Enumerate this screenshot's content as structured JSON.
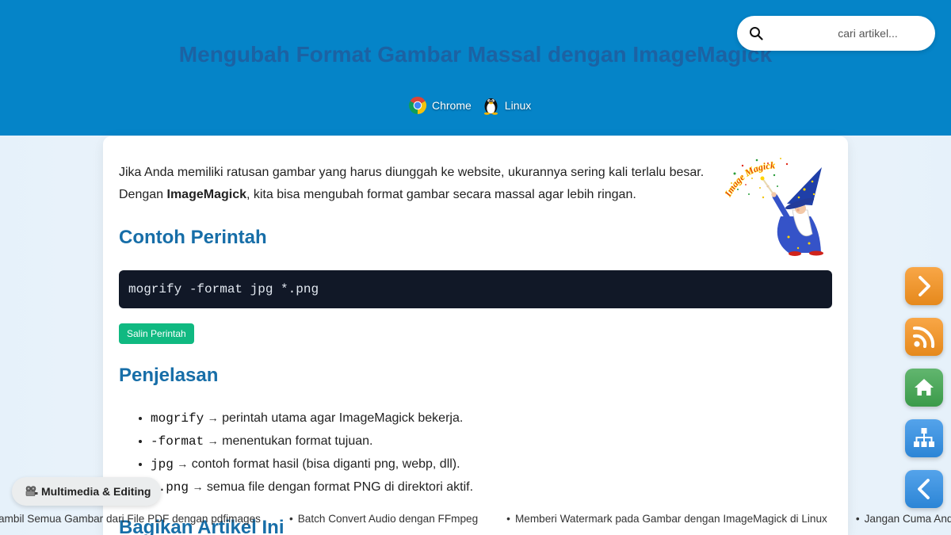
{
  "colors": {
    "header_bg": "#0584c8",
    "title": "#1c62a3",
    "heading": "#176ea8",
    "code_bg": "#111827",
    "copy_button": "#10b981",
    "nav_orange": "#f7931e",
    "nav_green": "#3fa64f",
    "nav_blue": "#2f8fe6"
  },
  "header": {
    "title": "Mengubah Format Gambar Massal dengan ImageMagick",
    "search": {
      "icon": "search-icon",
      "placeholder": "cari artikel..."
    },
    "tags": [
      {
        "icon": "chrome-icon",
        "label": "Chrome"
      },
      {
        "icon": "linux-penguin-icon",
        "label": "Linux"
      }
    ]
  },
  "article": {
    "logo": {
      "icon": "imagemagick-wizard-logo",
      "text": "Image Magick"
    },
    "intro": {
      "before": "Jika Anda memiliki ratusan gambar yang harus diunggah ke website, ukurannya sering kali terlalu besar. Dengan ",
      "bold": "ImageMagick",
      "after": ", kita bisa mengubah format gambar secara massal agar lebih ringan."
    },
    "example": {
      "heading": "Contoh Perintah",
      "command": "mogrify -format jpg *.png",
      "copy_label": "Salin Perintah"
    },
    "explanation": {
      "heading": "Penjelasan",
      "items": [
        {
          "code": "mogrify",
          "arrow": "→",
          "text": "perintah utama agar ImageMagick bekerja."
        },
        {
          "code": "-format",
          "arrow": "→",
          "text": "menentukan format tujuan."
        },
        {
          "code": "jpg",
          "arrow": "→",
          "text": "contoh format hasil (bisa diganti png, webp, dll)."
        },
        {
          "code": "*.png",
          "arrow": "→",
          "text": "semua file dengan format PNG di direktori aktif."
        }
      ]
    },
    "share": {
      "heading": "Bagikan Artikel Ini"
    }
  },
  "floating_nav": [
    {
      "icon": "chevron-right-icon",
      "color": "orange"
    },
    {
      "icon": "rss-icon",
      "color": "orange"
    },
    {
      "icon": "home-icon",
      "color": "green"
    },
    {
      "icon": "sitemap-icon",
      "color": "blue"
    },
    {
      "icon": "chevron-left-icon",
      "color": "blue"
    }
  ],
  "category_badge": {
    "icon": "projector-icon",
    "label": "Multimedia & Editing"
  },
  "ticker": {
    "items": [
      "ambil Semua Gambar dari File PDF dengan pdfimages",
      "Batch Convert Audio dengan FFmpeg",
      "Memberi Watermark pada Gambar dengan ImageMagick di Linux",
      "Jangan Cuma Anda"
    ]
  }
}
